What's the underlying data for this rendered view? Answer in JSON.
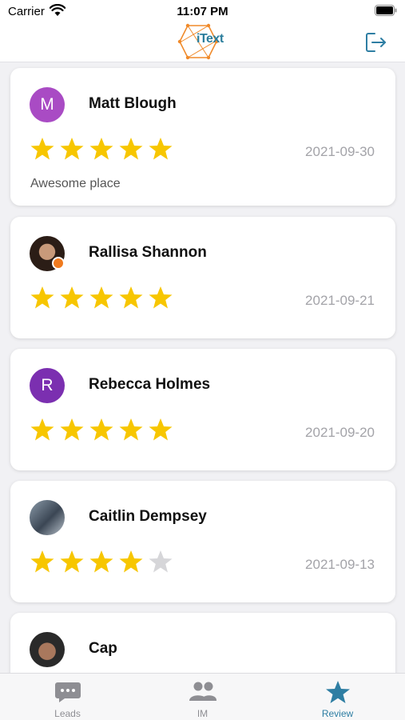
{
  "status_bar": {
    "carrier": "Carrier",
    "time": "11:07 PM"
  },
  "header": {
    "logo_text": "iText",
    "logout_icon": "logout-icon"
  },
  "reviews": [
    {
      "name": "Matt Blough",
      "avatar_letter": "M",
      "avatar_color": "#a94bc4",
      "rating": 5,
      "date": "2021-09-30",
      "text": "Awesome place"
    },
    {
      "name": "Rallisa Shannon",
      "avatar_letter": "",
      "avatar_color": "#3a2a22",
      "rating": 5,
      "date": "2021-09-21",
      "text": ""
    },
    {
      "name": "Rebecca Holmes",
      "avatar_letter": "R",
      "avatar_color": "#7b2fb0",
      "rating": 5,
      "date": "2021-09-20",
      "text": ""
    },
    {
      "name": "Caitlin Dempsey",
      "avatar_letter": "",
      "avatar_color": "#5d6a78",
      "rating": 4,
      "date": "2021-09-13",
      "text": ""
    },
    {
      "name": "Cap",
      "avatar_letter": "",
      "avatar_color": "#3b3b3b",
      "rating": 0,
      "date": "",
      "text": ""
    }
  ],
  "tabs": [
    {
      "label": "Leads",
      "icon": "chat-bubble-icon",
      "active": false
    },
    {
      "label": "IM",
      "icon": "people-icon",
      "active": false
    },
    {
      "label": "Review",
      "icon": "star-icon",
      "active": true
    }
  ],
  "colors": {
    "star_filled": "#f7c600",
    "star_empty": "#d6d6d9",
    "accent": "#2e7ea3"
  }
}
